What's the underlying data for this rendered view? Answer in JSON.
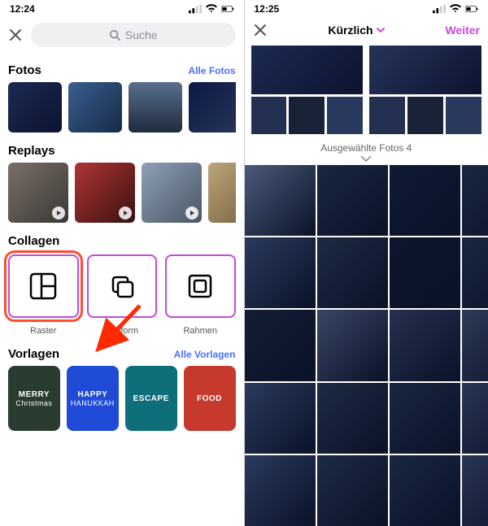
{
  "left": {
    "time": "12:24",
    "search_placeholder": "Suche",
    "sections": {
      "fotos": {
        "title": "Fotos",
        "see_all": "Alle Fotos"
      },
      "replays": {
        "title": "Replays"
      },
      "collagen": {
        "title": "Collagen",
        "items": [
          "Raster",
          "Freiform",
          "Rahmen"
        ]
      },
      "vorlagen": {
        "title": "Vorlagen",
        "see_all": "Alle Vorlagen",
        "templates": [
          {
            "line1": "MERRY",
            "line2": "Christmas",
            "bg": "#2a3b2f"
          },
          {
            "line1": "HAPPY",
            "line2": "HANUKKAH",
            "bg": "#1f4bd6"
          },
          {
            "line1": "ESCAPE",
            "line2": "",
            "bg": "#0e6f7a"
          },
          {
            "line1": "FOOD",
            "line2": "",
            "bg": "#c63a2e"
          }
        ]
      }
    },
    "photos": [
      "linear-gradient(135deg,#1c2a52,#0d1330)",
      "linear-gradient(135deg,#3a5e8f,#162a47)",
      "linear-gradient(180deg,#5a6f8c,#1e2b3e)",
      "linear-gradient(135deg,#0c1a44,#28345a)"
    ],
    "replays": [
      "linear-gradient(135deg,#7a6f68,#3b3834)",
      "linear-gradient(135deg,#b03434,#3a1010)",
      "linear-gradient(135deg,#8ea0b5,#4a5766)",
      "linear-gradient(135deg,#bca57a,#6e5b3a)"
    ]
  },
  "right": {
    "time": "12:25",
    "sort_label": "Kürzlich",
    "next_label": "Weiter",
    "selected_label": "Ausgewählte Fotos 4",
    "preview_tiles": [
      "#2a3a5e",
      "#1e2a44",
      "#233050",
      "#1a2238"
    ],
    "grid_tiles": [
      "#4a5a7a",
      "#1a2642",
      "#0f1a34",
      "#1a2642",
      "#172039",
      "#2a3a5e",
      "#1e2a44",
      "#0e162e",
      "#1a2642",
      "#3a4a6e",
      "#141d33",
      "#3a4666",
      "#26314e",
      "#2e3a58",
      "#333f5c",
      "#2a3a5e",
      "#1e2a44",
      "#1a2642",
      "#2a3556",
      "#1a2238",
      "#2a3a5e",
      "#1e2a44",
      "#1a2642",
      "#2a3556",
      "#1a2238"
    ]
  }
}
